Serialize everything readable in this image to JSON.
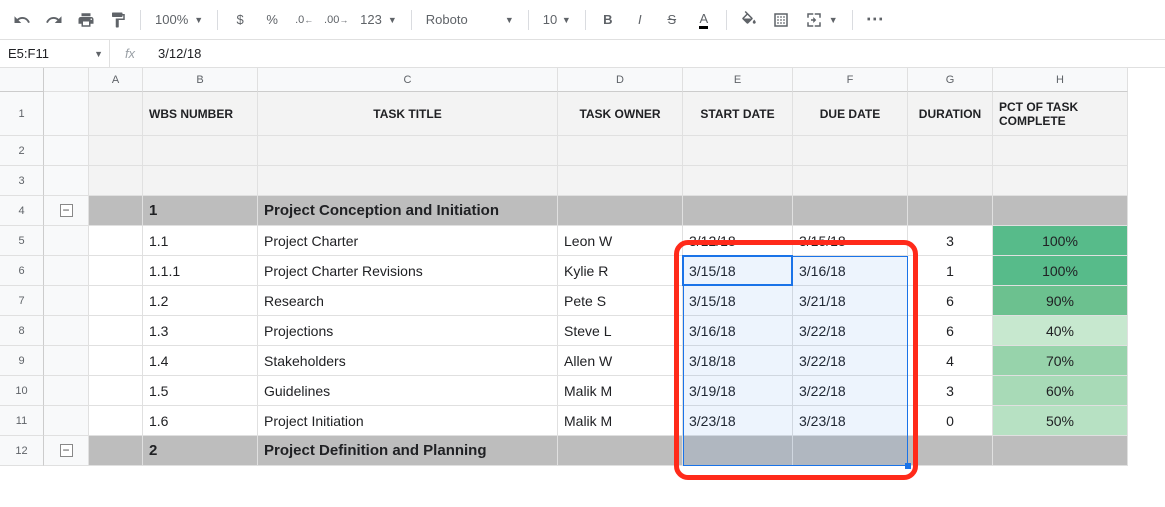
{
  "toolbar": {
    "zoom": "100%",
    "currency": "$",
    "percent": "%",
    "dec_dec": ".0",
    "inc_dec": ".00",
    "num_fmt": "123",
    "font": "Roboto",
    "font_size": "10",
    "bold": "B",
    "italic": "I",
    "strike": "S",
    "text_color": "A",
    "more": "⋯"
  },
  "formula_bar": {
    "name_box": "E5:F11",
    "fx": "fx",
    "value": "3/12/18"
  },
  "columns": [
    "A",
    "B",
    "C",
    "D",
    "E",
    "F",
    "G",
    "H"
  ],
  "row_numbers": [
    "1",
    "2",
    "3",
    "4",
    "5",
    "6",
    "7",
    "8",
    "9",
    "10",
    "11",
    "12"
  ],
  "headers": {
    "wbs": "WBS NUMBER",
    "title": "TASK TITLE",
    "owner": "TASK OWNER",
    "start": "START DATE",
    "due": "DUE DATE",
    "duration": "DURATION",
    "pct": "PCT OF TASK COMPLETE"
  },
  "sections": {
    "s1_num": "1",
    "s1_title": "Project Conception and Initiation",
    "s2_num": "2",
    "s2_title": "Project Definition and Planning"
  },
  "tasks": [
    {
      "wbs": "1.1",
      "title": "Project Charter",
      "owner": "Leon W",
      "start": "3/12/18",
      "due": "3/15/18",
      "dur": "3",
      "pct": "100%",
      "color": "#57bb8a"
    },
    {
      "wbs": "1.1.1",
      "title": "Project Charter Revisions",
      "owner": "Kylie R",
      "start": "3/15/18",
      "due": "3/16/18",
      "dur": "1",
      "pct": "100%",
      "color": "#57bb8a"
    },
    {
      "wbs": "1.2",
      "title": "Research",
      "owner": "Pete S",
      "start": "3/15/18",
      "due": "3/21/18",
      "dur": "6",
      "pct": "90%",
      "color": "#6cc18f"
    },
    {
      "wbs": "1.3",
      "title": "Projections",
      "owner": "Steve L",
      "start": "3/16/18",
      "due": "3/22/18",
      "dur": "6",
      "pct": "40%",
      "color": "#c7e8cf"
    },
    {
      "wbs": "1.4",
      "title": "Stakeholders",
      "owner": "Allen W",
      "start": "3/18/18",
      "due": "3/22/18",
      "dur": "4",
      "pct": "70%",
      "color": "#97d3ab"
    },
    {
      "wbs": "1.5",
      "title": "Guidelines",
      "owner": "Malik M",
      "start": "3/19/18",
      "due": "3/22/18",
      "dur": "3",
      "pct": "60%",
      "color": "#a8dab7"
    },
    {
      "wbs": "1.6",
      "title": "Project Initiation",
      "owner": "Malik M",
      "start": "3/23/18",
      "due": "3/23/18",
      "dur": "0",
      "pct": "50%",
      "color": "#b7e1c3"
    }
  ]
}
